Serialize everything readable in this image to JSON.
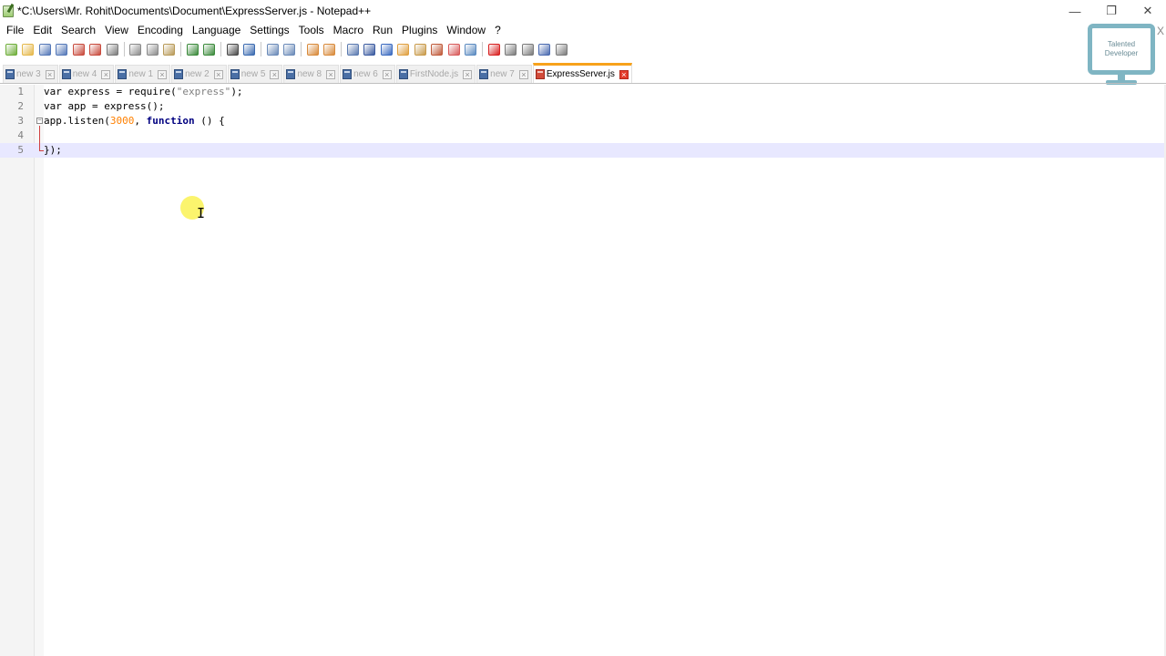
{
  "window": {
    "title": "*C:\\Users\\Mr. Rohit\\Documents\\Document\\ExpressServer.js - Notepad++",
    "controls": {
      "minimize": "—",
      "restore": "❐",
      "close": "✕"
    }
  },
  "menu": [
    "File",
    "Edit",
    "Search",
    "View",
    "Encoding",
    "Language",
    "Settings",
    "Tools",
    "Macro",
    "Run",
    "Plugins",
    "Window",
    "?"
  ],
  "toolbar": {
    "buttons": [
      {
        "icon": "new-file-icon",
        "color": "#6fae3a"
      },
      {
        "icon": "open-file-icon",
        "color": "#e5b84b"
      },
      {
        "icon": "save-icon",
        "color": "#5478b8"
      },
      {
        "icon": "save-all-icon",
        "color": "#5478b8"
      },
      {
        "icon": "close-icon",
        "color": "#c84a3c"
      },
      {
        "icon": "close-all-icon",
        "color": "#c84a3c"
      },
      {
        "icon": "print-icon",
        "color": "#7a7a7a"
      },
      {
        "sep": true
      },
      {
        "icon": "cut-icon",
        "color": "#8a8a8a"
      },
      {
        "icon": "copy-icon",
        "color": "#8a8a8a"
      },
      {
        "icon": "paste-icon",
        "color": "#b89a58"
      },
      {
        "sep": true
      },
      {
        "icon": "undo-icon",
        "color": "#3b8a3b"
      },
      {
        "icon": "redo-icon",
        "color": "#3b8a3b"
      },
      {
        "sep": true
      },
      {
        "icon": "find-icon",
        "color": "#4a4a4a"
      },
      {
        "icon": "replace-icon",
        "color": "#3a6ab0"
      },
      {
        "sep": true
      },
      {
        "icon": "zoom-in-icon",
        "color": "#6a8ab8"
      },
      {
        "icon": "zoom-out-icon",
        "color": "#6a8ab8"
      },
      {
        "sep": true
      },
      {
        "icon": "sync-vertical-icon",
        "color": "#d88a3a"
      },
      {
        "icon": "sync-horizontal-icon",
        "color": "#d88a3a"
      },
      {
        "sep": true
      },
      {
        "icon": "word-wrap-icon",
        "color": "#5a7ab0"
      },
      {
        "icon": "show-all-chars-icon",
        "color": "#3a5aa0"
      },
      {
        "icon": "indent-guide-icon",
        "color": "#3a6ac0"
      },
      {
        "icon": "user-language-icon",
        "color": "#e0a040"
      },
      {
        "icon": "doc-map-icon",
        "color": "#c89a4a"
      },
      {
        "icon": "function-list-icon",
        "color": "#c05a3a"
      },
      {
        "icon": "folder-workspace-icon",
        "color": "#d85a5a"
      },
      {
        "icon": "monitoring-icon",
        "color": "#5a8ac0"
      },
      {
        "sep": true
      },
      {
        "icon": "record-macro-icon",
        "color": "#d82020"
      },
      {
        "icon": "stop-macro-icon",
        "color": "#7a7a7a"
      },
      {
        "icon": "play-macro-icon",
        "color": "#7a7a7a"
      },
      {
        "icon": "run-macro-multiple-icon",
        "color": "#4a6ab0"
      },
      {
        "icon": "save-macro-icon",
        "color": "#7a7a7a"
      }
    ]
  },
  "logo": {
    "line1": "Talented",
    "line2": "Developer",
    "close": "X"
  },
  "tabs": [
    {
      "label": "new 3",
      "active": false
    },
    {
      "label": "new 4",
      "active": false
    },
    {
      "label": "new 1",
      "active": false
    },
    {
      "label": "new 2",
      "active": false
    },
    {
      "label": "new 5",
      "active": false
    },
    {
      "label": "new 8",
      "active": false
    },
    {
      "label": "new 6",
      "active": false
    },
    {
      "label": "FirstNode.js",
      "active": false
    },
    {
      "label": "new 7",
      "active": false
    },
    {
      "label": "ExpressServer.js",
      "active": true
    }
  ],
  "editor": {
    "lines": [
      {
        "n": "1",
        "parts": [
          {
            "t": "var express = require(",
            "c": ""
          },
          {
            "t": "\"express\"",
            "c": "str"
          },
          {
            "t": ");",
            "c": ""
          }
        ]
      },
      {
        "n": "2",
        "parts": [
          {
            "t": "var app = express();",
            "c": ""
          }
        ]
      },
      {
        "n": "3",
        "parts": [
          {
            "t": "app.listen(",
            "c": ""
          },
          {
            "t": "3000",
            "c": "num"
          },
          {
            "t": ", ",
            "c": ""
          },
          {
            "t": "function",
            "c": "kw"
          },
          {
            "t": " () {",
            "c": ""
          }
        ]
      },
      {
        "n": "4",
        "parts": [
          {
            "t": "",
            "c": ""
          }
        ]
      },
      {
        "n": "5",
        "parts": [
          {
            "t": "});",
            "c": ""
          }
        ]
      }
    ],
    "current_line": 5
  }
}
